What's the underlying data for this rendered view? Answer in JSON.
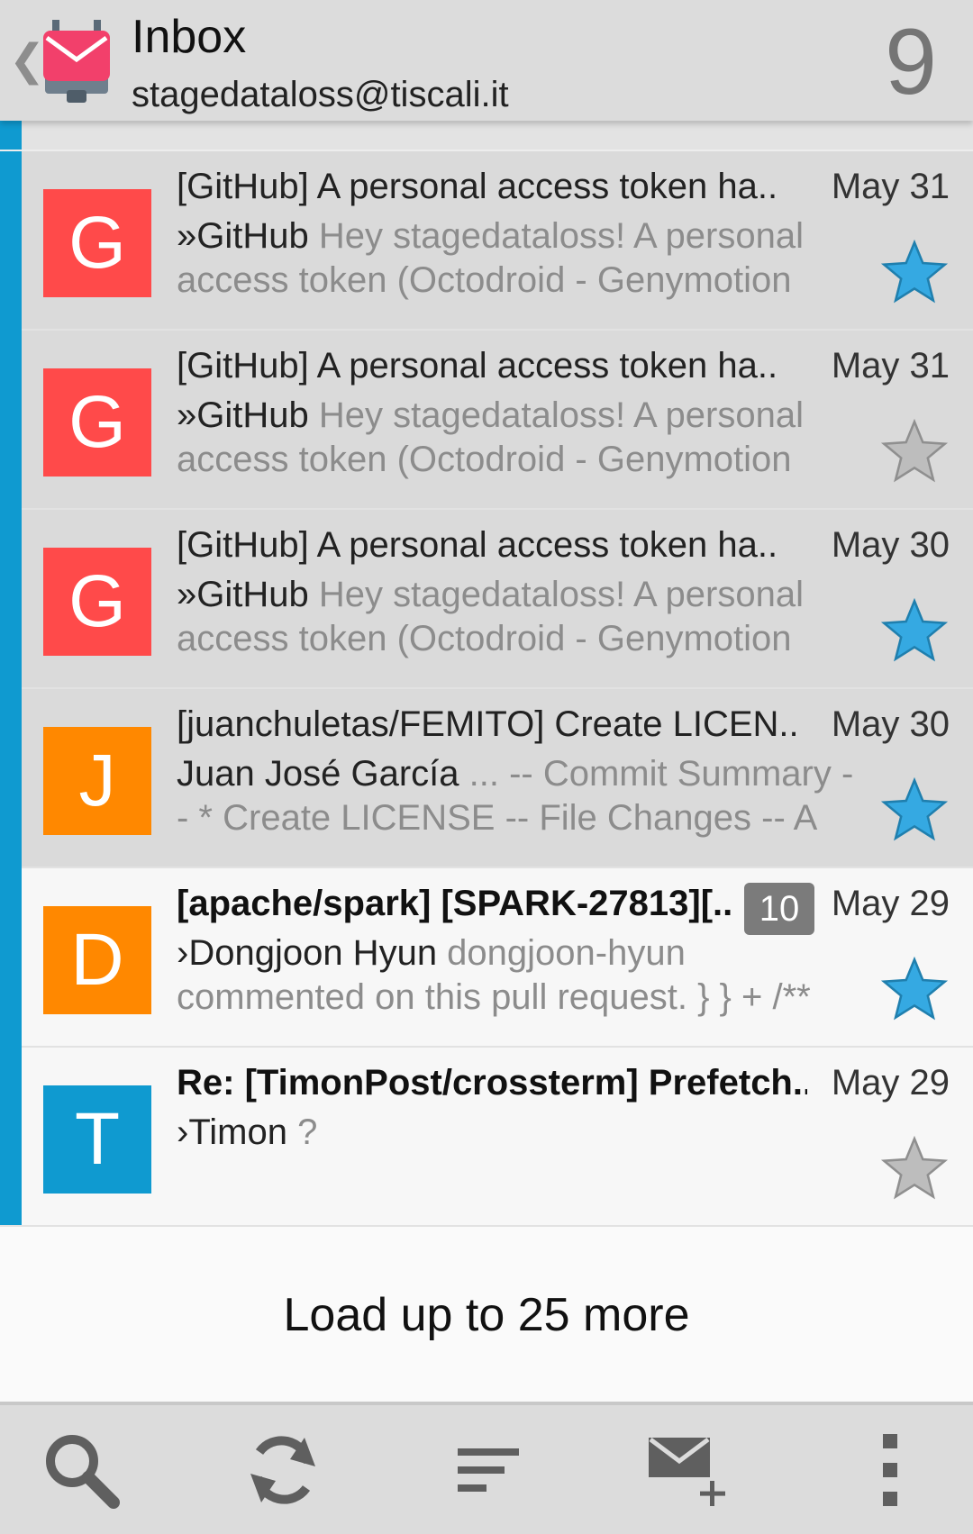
{
  "header": {
    "title": "Inbox",
    "account": "stagedataloss@tiscali.it",
    "unread_count": "9",
    "back_icon": "chevron-left-icon",
    "logo_icon": "k9-mail-logo"
  },
  "colors": {
    "chip": "#0f9ad0",
    "star_on": "#35a9e2",
    "star_off": "#a9a9a9",
    "avatar_g": "#ff4a4a",
    "avatar_j": "#ff8800",
    "avatar_t": "#0f9ad0"
  },
  "messages": [
    {
      "avatar_letter": "G",
      "subject": "[GitHub] A personal access token ha..",
      "date": "May 31",
      "sender": "»GitHub",
      "preview": " Hey stagedataloss! A personal access token (Octodroid - Genymotion",
      "starred": true,
      "read": true
    },
    {
      "avatar_letter": "G",
      "subject": "[GitHub] A personal access token ha..",
      "date": "May 31",
      "sender": "»GitHub",
      "preview": " Hey stagedataloss! A personal access token (Octodroid - Genymotion",
      "starred": false,
      "read": true
    },
    {
      "avatar_letter": "G",
      "subject": "[GitHub] A personal access token ha..",
      "date": "May 30",
      "sender": "»GitHub",
      "preview": " Hey stagedataloss! A personal access token (Octodroid - Genymotion",
      "starred": true,
      "read": true
    },
    {
      "avatar_letter": "J",
      "subject": "[juanchuletas/FEMITO] Create LICEN..",
      "date": "May 30",
      "sender": "Juan José García",
      "preview": " ... -- Commit Summary -- * Create LICENSE -- File Changes -- A",
      "starred": true,
      "read": true
    },
    {
      "avatar_letter": "D",
      "subject": "[apache/spark] [SPARK-27813][..",
      "thread_count": "10",
      "date": "May 29",
      "sender": "›Dongjoon Hyun",
      "preview": " dongjoon-hyun commented on this pull request. } } + /**",
      "starred": true,
      "read": false
    },
    {
      "avatar_letter": "T",
      "subject": "Re: [TimonPost/crossterm] Prefetch..",
      "date": "May 29",
      "sender": "›Timon",
      "preview": " ?",
      "starred": false,
      "read": false
    }
  ],
  "load_more_label": "Load up to 25 more",
  "bottom_bar": {
    "icons": [
      "search-icon",
      "refresh-icon",
      "sort-icon",
      "compose-icon",
      "overflow-menu-icon"
    ]
  }
}
